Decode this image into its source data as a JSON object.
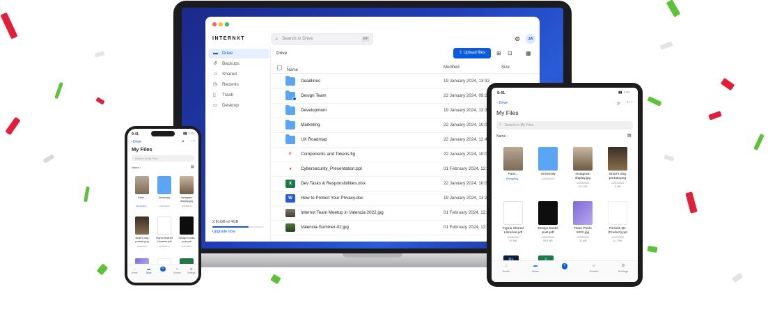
{
  "laptop": {
    "brand": "INTERNXT",
    "search_placeholder": "Search in Drive",
    "search_shortcut": "⌘F",
    "avatar_initials": "JA",
    "sidebar": [
      {
        "label": "Drive",
        "icon": "folder-icon"
      },
      {
        "label": "Backups",
        "icon": "history-icon"
      },
      {
        "label": "Shared",
        "icon": "users-icon"
      },
      {
        "label": "Recents",
        "icon": "clock-icon"
      },
      {
        "label": "Trash",
        "icon": "trash-icon"
      },
      {
        "label": "Desktop",
        "icon": "monitor-icon"
      }
    ],
    "storage_text": "2.81GB of 4GB",
    "storage_fraction": 0.7,
    "upgrade_label": "Upgrade now",
    "breadcrumb": "Drive",
    "upload_label": "Upload files",
    "columns": {
      "name": "Name",
      "modified": "Modified",
      "size": "Size"
    },
    "files": [
      {
        "name": "Deadlines",
        "modified": "19 January 2024, 13:32",
        "kind": "folder"
      },
      {
        "name": "Design Team",
        "modified": "22 January 2024, 09:2",
        "kind": "folder-shared"
      },
      {
        "name": "Development",
        "modified": "19 January 2024, 13:34",
        "kind": "folder"
      },
      {
        "name": "Marketing",
        "modified": "22 January 2024, 10:0",
        "kind": "folder"
      },
      {
        "name": "UX Roadmap",
        "modified": "22 January 2024, 12:4",
        "kind": "folder"
      },
      {
        "name": "Components and Tokens.fig",
        "modified": "22 January 2024, 10:0",
        "kind": "figma"
      },
      {
        "name": "Cybersecurity_Presentation.ppt",
        "modified": "01 February 2024, 12:3",
        "kind": "ppt"
      },
      {
        "name": "Dev Tasks & Responsibilities.xlsx",
        "modified": "22 January 2024, 10:0",
        "kind": "xlsx"
      },
      {
        "name": "How to Protect Your Privacy.doc",
        "modified": "19 January 2024, 13:2",
        "kind": "doc"
      },
      {
        "name": "Internxt Team Meetup in Valencia 2022.jpg",
        "modified": "01 February 2024, 12:3",
        "kind": "photo"
      },
      {
        "name": "Valencia-Summer-02.jpg",
        "modified": "01 February 2024, 12:3",
        "kind": "photo-green"
      }
    ]
  },
  "phone": {
    "time": "9:41",
    "back_label": "Drive",
    "title": "My Files",
    "search_placeholder": "Search in My Files",
    "sort_label": "Name",
    "items": [
      {
        "name": "Paris...",
        "meta": "Encrypting...",
        "kind": "photo-cat"
      },
      {
        "name": "University",
        "meta": "12/03/2024",
        "kind": "folder"
      },
      {
        "name": "Instagram display.jpg",
        "meta": "12/03/2024",
        "kind": "photo-dog"
      },
      {
        "name": "Brian's dog portrait.png",
        "meta": "12/03/2024",
        "kind": "photo-dog2"
      },
      {
        "name": "Figma Shared Libraries.pdf",
        "meta": "12/03/2024",
        "kind": "pdf-white"
      },
      {
        "name": "Design books post.pdf",
        "meta": "12/03/2024",
        "kind": "pdf-black"
      }
    ],
    "tabs": [
      "Home",
      "Drive",
      "",
      "Shared",
      "Settings"
    ]
  },
  "tablet": {
    "time": "9:41",
    "back_label": "Drive",
    "title": "My Files",
    "search_placeholder": "Search in My Files",
    "sort_label": "Name",
    "items": [
      {
        "name": "Paris...",
        "meta": "Encrypting...",
        "kind": "photo-cat"
      },
      {
        "name": "University",
        "meta": "12/03/2024",
        "kind": "folder"
      },
      {
        "name": "Instagram display.jpg",
        "meta": "12/03/2024",
        "meta2": "16,2 MB",
        "kind": "photo-dog"
      },
      {
        "name": "Brian's dog portrait.png",
        "meta": "12/03/2024",
        "meta2": "8 MB",
        "kind": "photo-dog2"
      },
      {
        "name": "Figma Shared Libraries.pdf",
        "meta": "12/03/2024",
        "meta2": "87 MB",
        "kind": "pdf-white"
      },
      {
        "name": "Design books post.pdf",
        "meta": "12/03/2024",
        "meta2": "99,8 MB",
        "kind": "pdf-black"
      },
      {
        "name": "Team Photo 2022.jpg",
        "meta": "12/03/2024",
        "meta2": "30 MB",
        "kind": "photo-purple"
      },
      {
        "name": "Results Q1 (Product).ppt",
        "meta": "12/03/2024",
        "meta2": "42,7 MB",
        "kind": "ppt"
      }
    ],
    "tabs": [
      "Home",
      "Drive",
      "",
      "Shared",
      "Settings"
    ]
  },
  "colors": {
    "accent": "#0a5be0",
    "folder": "#5aa6f4",
    "wallpaper": "#1f3fb8"
  }
}
